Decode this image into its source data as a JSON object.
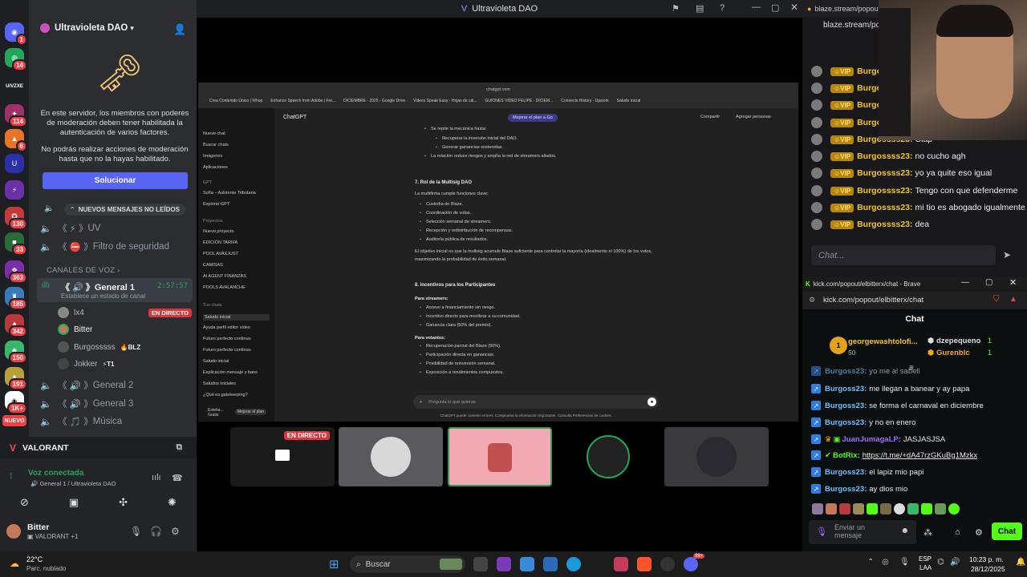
{
  "window": {
    "title": "Ultravioleta DAO"
  },
  "rail": {
    "badges": [
      "1",
      "14",
      "114",
      "6",
      "130",
      "33",
      "363",
      "185",
      "342",
      "150",
      "191",
      "1K+",
      "1K+"
    ],
    "new_label": "NUEVO",
    "logo_text": "U/VZXE"
  },
  "server": {
    "name": "Ultravioleta DAO",
    "notice": "En este servidor, los miembros con poderes de moderación deben tener habilitada la autenticación de varios factores.",
    "notice2": "No podrás realizar acciones de moderación hasta que no la hayas habilitado.",
    "fix_button": "Solucionar",
    "new_messages": "NUEVOS MENSAJES NO LEÍDOS",
    "channels": [
      {
        "name": "UV",
        "prefix": "《 ⚡ 》"
      },
      {
        "name": "Filtro de seguridad",
        "prefix": "《 ⛔ 》"
      }
    ],
    "voice_section": "CANALES DE VOZ",
    "voice_channel": {
      "name": "General 1",
      "prefix": "《 🔊 》",
      "time": "2:57:57",
      "status_placeholder": "Establece un estado de canal"
    },
    "voice_users": [
      {
        "name": "lx4",
        "tag": "",
        "live": "EN DIRECTO"
      },
      {
        "name": "Bitter",
        "tag": "",
        "live": ""
      },
      {
        "name": "Burgosssss",
        "tag": "BLZ",
        "live": ""
      },
      {
        "name": "Jokker",
        "tag": "T1",
        "live": ""
      }
    ],
    "other_voice": [
      {
        "name": "General 2",
        "prefix": "《 🔊 》"
      },
      {
        "name": "General 3",
        "prefix": "《 🔊 》"
      },
      {
        "name": "Música",
        "prefix": "《 🎵 》"
      }
    ],
    "activity": "VALORANT",
    "voice_connected": "Voz conectada",
    "voice_location": "General 1 / Ultravioleta DAO",
    "user": {
      "name": "Bitter",
      "status": "VALORANT +1"
    }
  },
  "stream": {
    "live_label": "EN DIRECTO",
    "browser_url": "chatgpt.com",
    "bookmarks": [
      "Crea Contenido Único | Whop",
      "Enhance Speech from Adobe | Fre...",
      "DICIEMBRE - 2025 - Google Drive",
      "Videos Speak Easy - Hojas de cál...",
      "GUIONES VIDEO FELIPE - DICIEM...",
      "Connects History - Upwork",
      "Saludo inicial"
    ],
    "app_title": "ChatGPT",
    "upgrade": "Mejorar el plan a Go",
    "share": "Compartir",
    "add_people": "Agregar personas",
    "sidebar_items": [
      "Nuevo chat",
      "Buscar chats",
      "Imágenes",
      "Aplicaciones",
      "GPT",
      "Sofía – Asistente Tributaria",
      "Explorar GPT",
      "Proyectos",
      "Nuevo proyecto",
      "EDICIÓN TARIFA",
      "POOL AVAXJUST",
      "CAMISAS",
      "AI AGENT FINANZAS",
      "POOLS AVALANCHE",
      "Tus chats",
      "Saludo inicial",
      "Ayuda perfil editor video",
      "Futuro perfecto continuo",
      "Futuro perfecto continuo",
      "Saludo inicial",
      "Explicación mensaje y bans",
      "Saludos iniciales",
      "¿Qué es gatekeeping?"
    ],
    "sidebar_user": "Esteba... Gratis",
    "sidebar_upgrade": "Mejorar el plan",
    "doc": {
      "intro": "Se repite la mecánica hasta:",
      "intro_items": [
        "Recuperar la inversión inicial del DAO.",
        "Generar ganancias sostenidas."
      ],
      "intro_tail": "La rotación reduce riesgos y amplía la red de streamers aliados.",
      "h7": "7. Rol de la Multisig DAO",
      "h7_sub": "La multifirma cumple funciones clave:",
      "h7_items": [
        "Custodia de Blaze.",
        "Coordinación de votos.",
        "Selección semanal de streamers.",
        "Recepción y redistribución de recompensas.",
        "Auditoría pública de resultados."
      ],
      "h7_para": "El objetivo inicial es que la multisig acumule Blaze suficiente para controlar la mayoría (idealmente el 100%) de los votos, maximizando la probabilidad de éxito semanal.",
      "h8": "8. Incentivos para los Participantes",
      "h8_streamers": "Para streamers:",
      "h8_streamers_items": [
        "Acceso a financiamiento sin riesgo.",
        "Incentivo directo para movilizar a su comunidad.",
        "Ganancia clara (50% del premio)."
      ],
      "h8_voters": "Para votantes:",
      "h8_voters_items": [
        "Recuperación parcial del Blaze (50%).",
        "Participación directa en ganancias.",
        "Posibilidad de reinversión semanal.",
        "Exposición a rendimientos compuestos."
      ],
      "input_placeholder": "Pregunta lo que quieras",
      "disclaimer": "ChatGPT puede cometer errores. Comprueba la información importante. Consulta Preferencias de cookies."
    }
  },
  "blaze": {
    "tab": "blaze.stream/popout/",
    "url": "blaze.stream/pop",
    "vip": "VIP",
    "messages": [
      {
        "user": "Burgo",
        "text": ""
      },
      {
        "user": "Burgo",
        "text": ""
      },
      {
        "user": "Burgo",
        "text": ""
      },
      {
        "user": "Burgo",
        "text": ""
      },
      {
        "user": "Burgossss23:",
        "text": "Clap"
      },
      {
        "user": "Burgossss23:",
        "text": "no cucho agh"
      },
      {
        "user": "Burgossss23:",
        "text": "yo ya quite eso igual"
      },
      {
        "user": "Burgossss23:",
        "text": "Tengo con que defenderme"
      },
      {
        "user": "Burgossss23:",
        "text": "mi tio es abogado igualmente"
      },
      {
        "user": "Burgossss23:",
        "text": "dea"
      }
    ],
    "chat_placeholder": "Chat..."
  },
  "kick": {
    "window_title": "kick.com/popout/elbitterx/chat - Brave",
    "url": "kick.com/popout/elbitterx/chat",
    "header": "Chat",
    "top_gifters": [
      {
        "name": "georgewashtolofi...",
        "count": "50",
        "rank": "1"
      },
      {
        "name": "dzepequeno",
        "count": "1"
      },
      {
        "name": "Gurenblc",
        "count": "1"
      }
    ],
    "messages": [
      {
        "user": "Burgoss23:",
        "text": "yo me al sabell"
      },
      {
        "user": "Burgoss23:",
        "text": "me llegan a banear y ay papa"
      },
      {
        "user": "Burgoss23:",
        "text": "se forma el carnaval en diciembre"
      },
      {
        "user": "Burgoss23:",
        "text": "y no en enero"
      },
      {
        "user": "JuanJumagaLP:",
        "text": "JASJASJSA"
      },
      {
        "user": "BotRix:",
        "text": "https://t.me/+dA47rzGKuBg1Mzkx"
      },
      {
        "user": "Burgoss23:",
        "text": "el lapiz mio papi"
      },
      {
        "user": "Burgoss23:",
        "text": "ay dios mio"
      }
    ],
    "input_placeholder": "Enviar un mensaje",
    "send_button": "Chat",
    "counter_1": "1"
  },
  "taskbar": {
    "weather_temp": "22°C",
    "weather_desc": "Parc. nublado",
    "search": "Buscar",
    "lang1": "ESP",
    "lang2": "LAA",
    "time": "10:23 p. m.",
    "date": "28/12/2025",
    "notif": "99+"
  },
  "colors": {
    "discord_blurple": "#5865f2",
    "live_red": "#da373c",
    "kick_green": "#53fc18",
    "vip_gold": "#f5c518"
  }
}
